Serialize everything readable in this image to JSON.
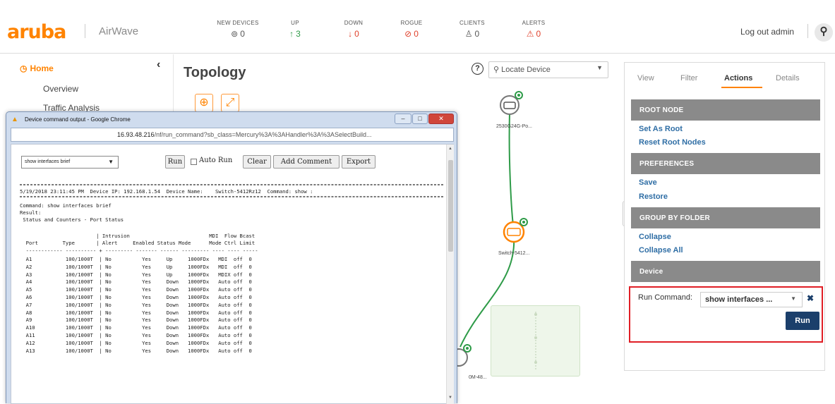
{
  "brand": {
    "logo": "aruba",
    "product": "AirWave"
  },
  "header": {
    "stats": [
      {
        "label": "NEW DEVICES",
        "icon": "new-devices-icon",
        "glyph": "⊚",
        "value": "0",
        "color": "#555555"
      },
      {
        "label": "UP",
        "icon": "up-arrow-icon",
        "glyph": "↑",
        "value": "3",
        "color": "#2e9b48"
      },
      {
        "label": "DOWN",
        "icon": "down-arrow-icon",
        "glyph": "↓",
        "value": "0",
        "color": "#e0422c"
      },
      {
        "label": "ROGUE",
        "icon": "rogue-icon",
        "glyph": "⊘",
        "value": "0",
        "color": "#e0422c"
      },
      {
        "label": "CLIENTS",
        "icon": "clients-icon",
        "glyph": "♙",
        "value": "0",
        "color": "#555555"
      },
      {
        "label": "ALERTS",
        "icon": "alert-icon",
        "glyph": "⚠",
        "value": "0",
        "color": "#e0422c"
      }
    ],
    "logout": "Log out admin"
  },
  "nav": {
    "home": "Home",
    "items": [
      "Overview",
      "Traffic Analysis"
    ]
  },
  "topology": {
    "title": "Topology",
    "locate_placeholder": "Locate Device",
    "nodes": {
      "top": "2530G24G-Po...",
      "middle": "Switch-5412...",
      "bottom": "0M-48..."
    }
  },
  "panel": {
    "tabs": [
      "View",
      "Filter",
      "Actions",
      "Details"
    ],
    "active_tab": "Actions",
    "sections": [
      {
        "title": "ROOT NODE",
        "links": [
          "Set As Root",
          "Reset Root Nodes"
        ]
      },
      {
        "title": "PREFERENCES",
        "links": [
          "Save",
          "Restore"
        ]
      },
      {
        "title": "GROUP BY FOLDER",
        "links": [
          "Collapse",
          "Collapse All"
        ]
      },
      {
        "title": "Device",
        "links": []
      }
    ],
    "run_command_label": "Run Command:",
    "run_command_value": "show interfaces ...",
    "run_button": "Run"
  },
  "popup": {
    "title": "Device command output - Google Chrome",
    "url_host": "16.93.48.216",
    "url_path": "/nf/run_command?sb_class=Mercury%3A%3AHandler%3A%3ASelectBuild...",
    "command_select": "show interfaces brief",
    "buttons": {
      "run": "Run",
      "auto_run": "Auto Run",
      "clear": "Clear",
      "add_comment": "Add Comment",
      "export": "Export"
    },
    "info_line": "5/19/2018 23:11:45 PM  Device IP: 192.168.1.54  Device Name:    Switch-5412Rz12  Command: show :",
    "command_line": "Command: show interfaces brief",
    "result_label": "Result:",
    "status_title": " Status and Counters - Port Status",
    "col_header_1": "                         | Intrusion                          MDI  Flow Bcast",
    "col_header_2": "  Port        Type       | Alert     Enabled Status Mode      Mode Ctrl Limit",
    "col_sep": "  ------------ ---------- + --------- ------- ------ --------- ---- ---- -----",
    "rows": [
      [
        "A1",
        "100/1000T",
        "No",
        "Yes",
        "Up",
        "1000FDx",
        "MDI",
        "off",
        "0"
      ],
      [
        "A2",
        "100/1000T",
        "No",
        "Yes",
        "Up",
        "1000FDx",
        "MDI",
        "off",
        "0"
      ],
      [
        "A3",
        "100/1000T",
        "No",
        "Yes",
        "Up",
        "1000FDx",
        "MDIX",
        "off",
        "0"
      ],
      [
        "A4",
        "100/1000T",
        "No",
        "Yes",
        "Down",
        "1000FDx",
        "Auto",
        "off",
        "0"
      ],
      [
        "A5",
        "100/1000T",
        "No",
        "Yes",
        "Down",
        "1000FDx",
        "Auto",
        "off",
        "0"
      ],
      [
        "A6",
        "100/1000T",
        "No",
        "Yes",
        "Down",
        "1000FDx",
        "Auto",
        "off",
        "0"
      ],
      [
        "A7",
        "100/1000T",
        "No",
        "Yes",
        "Down",
        "1000FDx",
        "Auto",
        "off",
        "0"
      ],
      [
        "A8",
        "100/1000T",
        "No",
        "Yes",
        "Down",
        "1000FDx",
        "Auto",
        "off",
        "0"
      ],
      [
        "A9",
        "100/1000T",
        "No",
        "Yes",
        "Down",
        "1000FDx",
        "Auto",
        "off",
        "0"
      ],
      [
        "A10",
        "100/1000T",
        "No",
        "Yes",
        "Down",
        "1000FDx",
        "Auto",
        "off",
        "0"
      ],
      [
        "A11",
        "100/1000T",
        "No",
        "Yes",
        "Down",
        "1000FDx",
        "Auto",
        "off",
        "0"
      ],
      [
        "A12",
        "100/1000T",
        "No",
        "Yes",
        "Down",
        "1000FDx",
        "Auto",
        "off",
        "0"
      ],
      [
        "A13",
        "100/1000T",
        "No",
        "Yes",
        "Down",
        "1000FDx",
        "Auto",
        "off",
        "0"
      ]
    ]
  },
  "colors": {
    "brand": "#ff8300",
    "link": "#2f6ea5",
    "section": "#8a8a8a",
    "run_button": "#1b3f6b",
    "highlight": "#e01e25",
    "edge": "#2e9b48"
  }
}
